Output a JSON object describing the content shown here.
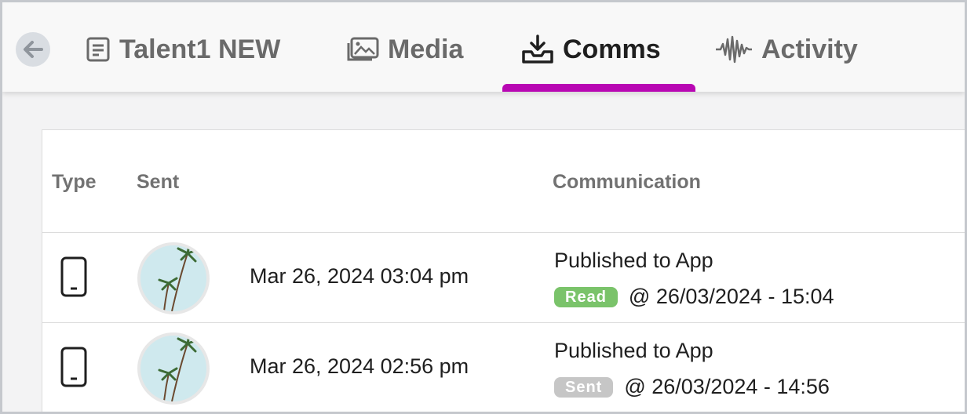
{
  "nav": {
    "tabs": [
      {
        "label": "Talent1 NEW",
        "icon": "document-icon"
      },
      {
        "label": "Media",
        "icon": "images-icon"
      },
      {
        "label": "Comms",
        "icon": "inbox-download-icon",
        "active": true
      },
      {
        "label": "Activity",
        "icon": "waveform-icon"
      }
    ],
    "accent": "#b807b3"
  },
  "table": {
    "columns": [
      "Type",
      "Sent",
      "Communication"
    ],
    "rows": [
      {
        "type_icon": "mobile-phone-icon",
        "date": "Mar 26, 2024 03:04 pm",
        "title": "Published to App",
        "status": "Read",
        "status_color": "#7ac36a",
        "timestamp": "@ 26/03/2024 - 15:04"
      },
      {
        "type_icon": "mobile-phone-icon",
        "date": "Mar 26, 2024 02:56 pm",
        "title": "Published to App",
        "status": "Sent",
        "status_color": "#c6c6c6",
        "timestamp": "@ 26/03/2024 - 14:56"
      }
    ]
  }
}
